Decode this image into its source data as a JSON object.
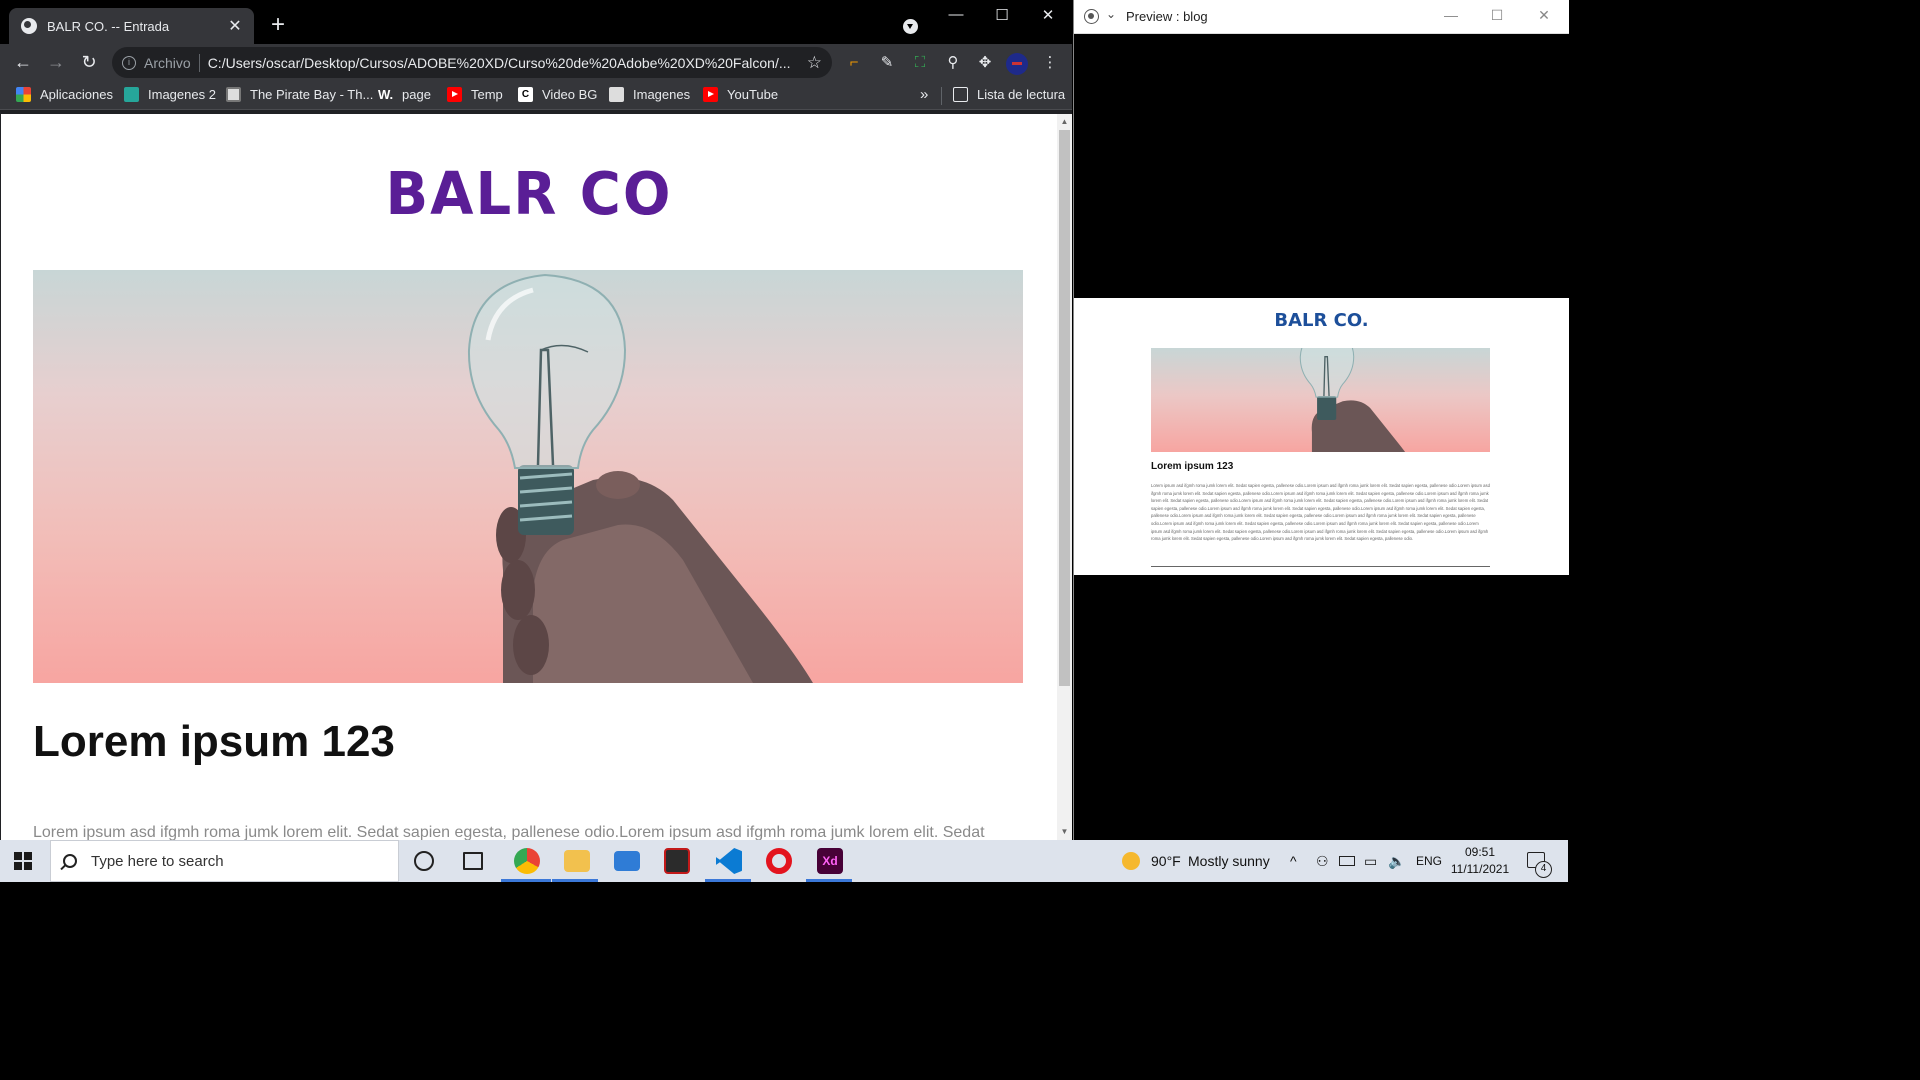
{
  "browser": {
    "tab": {
      "title": "BALR CO. -- Entrada",
      "close": "✕"
    },
    "new_tab": "+",
    "window_controls": {
      "minimize": "—",
      "maximize": "☐",
      "close": "✕"
    },
    "nav": {
      "back": "←",
      "forward": "→",
      "reload": "↻"
    },
    "omnibox": {
      "security_label": "Archivo",
      "url": "C:/Users/oscar/Desktop/Cursos/ADOBE%20XD/Curso%20de%20Adobe%20XD%20Falcon/...",
      "star": "☆"
    },
    "bookmarks": [
      {
        "label": "Aplicaciones",
        "icon": "apps-grid-icon"
      },
      {
        "label": "Imagenes 2",
        "icon": "teal-icon"
      },
      {
        "label": "The Pirate Bay - Th...",
        "icon": "pirate-icon"
      },
      {
        "label": "page",
        "icon": "w-icon"
      },
      {
        "label": "Temp",
        "icon": "youtube-icon"
      },
      {
        "label": "Video BG",
        "icon": "c-icon"
      },
      {
        "label": "Imagenes",
        "icon": "image-icon"
      },
      {
        "label": "YouTube",
        "icon": "youtube-icon"
      }
    ],
    "bookmarks_more": "»",
    "reading_list": "Lista de lectura"
  },
  "page": {
    "logo": "BALR CO",
    "post_title": "Lorem ipsum 123",
    "post_body": "Lorem ipsum asd ifgmh roma jumk lorem elit. Sedat sapien egesta, pallenese odio.Lorem ipsum asd ifgmh roma jumk lorem elit. Sedat"
  },
  "xd_preview": {
    "title": "Preview : blog",
    "logo": "BALR CO.",
    "post_title": "Lorem ipsum 123",
    "post_body": "Lorem ipsum asd ifgmh roma jumk lorem elit. Sedat sapien egesta, pallenese odio.Lorem ipsum asd ifgmh roma jumk lorem elit. Sedat sapien egesta, pallenese odio.Lorem ipsum asd ifgmh roma jumk lorem elit. Sedat sapien egesta, pallenese odio.Lorem ipsum asd ifgmh roma jumk lorem elit. Sedat sapien egesta, pallenese odio.Lorem ipsum asd ifgmh roma jumk lorem elit. Sedat sapien egesta, pallenese odio.Lorem ipsum asd ifgmh roma jumk lorem elit. Sedat sapien egesta, pallenese odio.Lorem ipsum asd ifgmh roma jumk lorem elit. Sedat sapien egesta, pallenese odio.Lorem ipsum asd ifgmh roma jumk lorem elit. Sedat sapien egesta, pallenese odio.Lorem ipsum asd ifgmh roma jumk lorem elit. Sedat sapien egesta, pallenese odio.Lorem ipsum asd ifgmh roma jumk lorem elit. Sedat sapien egesta, pallenese odio.Lorem ipsum asd ifgmh roma jumk lorem elit. Sedat sapien egesta, pallenese odio.Lorem ipsum asd ifgmh roma jumk lorem elit. Sedat sapien egesta, pallenese odio.Lorem ipsum asd ifgmh roma jumk lorem elit. Sedat sapien egesta, pallenese odio.Lorem ipsum asd ifgmh roma jumk lorem elit. Sedat sapien egesta, pallenese odio.Lorem ipsum asd ifgmh roma jumk lorem elit. Sedat sapien egesta, pallenese odio.Lorem ipsum asd ifgmh roma jumk lorem elit. Sedat sapien egesta, pallenese odio.Lorem ipsum asd ifgmh roma jumk lorem elit. Sedat sapien egesta, pallenese odio."
  },
  "taskbar": {
    "search_placeholder": "Type here to search",
    "apps": [
      "cortana-icon",
      "task-view-icon",
      "chrome-icon",
      "file-explorer-icon",
      "mail-icon",
      "game-icon",
      "vscode-icon",
      "opera-icon",
      "adobe-xd-icon"
    ],
    "weather": {
      "temp": "90°F",
      "condition": "Mostly sunny"
    },
    "language": "ENG",
    "time": "09:51",
    "date": "11/11/2021",
    "notifications_count": "4"
  },
  "colors": {
    "logo_purple": "#5a1e96",
    "xd_logo_blue": "#1d4f9a",
    "chrome_dark": "#35363a",
    "taskbar_bg": "#dde3ec"
  }
}
